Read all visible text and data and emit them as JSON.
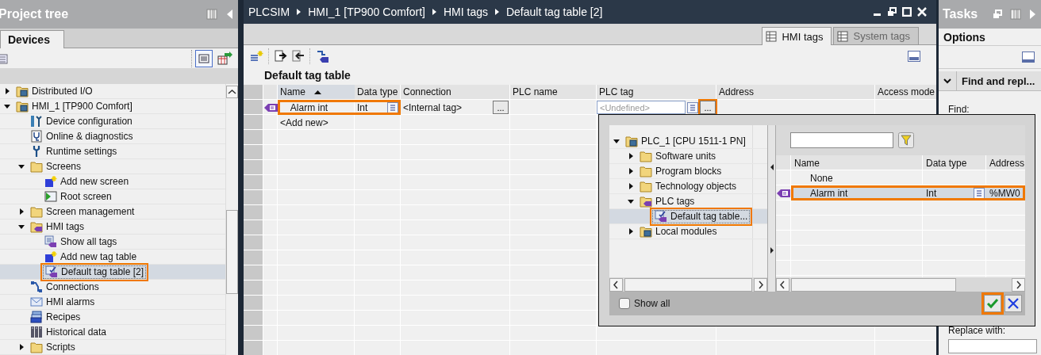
{
  "project_tree": {
    "title": "Project tree",
    "tabs": [
      {
        "label": "Devices",
        "selected": true
      }
    ],
    "items": [
      {
        "label": "Distributed I/O",
        "kind": "device-folder",
        "expanded": false,
        "selected": false,
        "highlighted": false
      },
      {
        "label": "HMI_1 [TP900 Comfort]",
        "kind": "device-folder",
        "expanded": true,
        "selected": false,
        "highlighted": false,
        "children": [
          {
            "label": "Device configuration",
            "kind": "config",
            "selected": false,
            "highlighted": false
          },
          {
            "label": "Online & diagnostics",
            "kind": "diagnostics",
            "selected": false,
            "highlighted": false
          },
          {
            "label": "Runtime settings",
            "kind": "runtime",
            "selected": false,
            "highlighted": false
          },
          {
            "label": "Screens",
            "kind": "folder",
            "expanded": true,
            "selected": false,
            "highlighted": false,
            "children": [
              {
                "label": "Add new screen",
                "kind": "add",
                "selected": false,
                "highlighted": false
              },
              {
                "label": "Root screen",
                "kind": "screen",
                "selected": false,
                "highlighted": false
              }
            ]
          },
          {
            "label": "Screen management",
            "kind": "folder",
            "expanded": false,
            "selected": false,
            "highlighted": false
          },
          {
            "label": "HMI tags",
            "kind": "tag-folder",
            "expanded": true,
            "selected": false,
            "highlighted": false,
            "children": [
              {
                "label": "Show all tags",
                "kind": "tags",
                "selected": false,
                "highlighted": false
              },
              {
                "label": "Add new tag table",
                "kind": "add",
                "selected": false,
                "highlighted": false
              },
              {
                "label": "Default tag table [2]",
                "kind": "tag-table",
                "selected": true,
                "highlighted": true
              }
            ]
          },
          {
            "label": "Connections",
            "kind": "connections",
            "selected": false,
            "highlighted": false
          },
          {
            "label": "HMI alarms",
            "kind": "alarms",
            "selected": false,
            "highlighted": false
          },
          {
            "label": "Recipes",
            "kind": "recipes",
            "selected": false,
            "highlighted": false
          },
          {
            "label": "Historical data",
            "kind": "historical",
            "selected": false,
            "highlighted": false
          },
          {
            "label": "Scripts",
            "kind": "folder",
            "expanded": false,
            "selected": false,
            "highlighted": false
          }
        ]
      }
    ]
  },
  "editor": {
    "breadcrumb": [
      "PLCSIM",
      "HMI_1 [TP900 Comfort]",
      "HMI tags",
      "Default tag table [2]"
    ],
    "tabs": [
      {
        "label": "HMI tags",
        "selected": true
      },
      {
        "label": "System tags",
        "selected": false
      }
    ],
    "table_title": "Default tag table",
    "columns": [
      {
        "label": "Name",
        "sorted": true
      },
      {
        "label": "Data type",
        "sorted": false
      },
      {
        "label": "Connection",
        "sorted": false
      },
      {
        "label": "PLC name",
        "sorted": false
      },
      {
        "label": "PLC tag",
        "sorted": false
      },
      {
        "label": "Address",
        "sorted": false
      },
      {
        "label": "Access mode",
        "sorted": false
      }
    ],
    "rows": [
      {
        "name": "Alarm int",
        "data_type": "Int",
        "connection": "<Internal tag>",
        "connection_button": "...",
        "plc_tag": {
          "placeholder": "<Undefined>",
          "button": "...",
          "button_highlighted": true
        },
        "highlighted": true
      }
    ],
    "add_row": "<Add new>"
  },
  "tag_picker": {
    "tree": [
      {
        "label": "PLC_1 [CPU 1511-1 PN]",
        "kind": "device-folder",
        "expanded": true,
        "selected": false,
        "highlighted": false,
        "children": [
          {
            "label": "Software units",
            "kind": "folder",
            "expanded": false,
            "selected": false,
            "highlighted": false
          },
          {
            "label": "Program blocks",
            "kind": "folder",
            "expanded": false,
            "selected": false,
            "highlighted": false
          },
          {
            "label": "Technology objects",
            "kind": "folder",
            "expanded": false,
            "selected": false,
            "highlighted": false
          },
          {
            "label": "PLC tags",
            "kind": "tag-folder",
            "expanded": true,
            "selected": false,
            "highlighted": false,
            "children": [
              {
                "label": "Default tag table...",
                "kind": "tag-table",
                "selected": true,
                "highlighted": true
              }
            ]
          },
          {
            "label": "Local modules",
            "kind": "device-folder",
            "expanded": false,
            "selected": false,
            "highlighted": false
          }
        ]
      }
    ],
    "columns": [
      "Name",
      "Data type",
      "Address"
    ],
    "rows": [
      {
        "name": "None",
        "selected": false,
        "highlighted": false
      },
      {
        "name": "Alarm int",
        "data_type": "Int",
        "address": "%MW0",
        "selected": true,
        "highlighted": true
      }
    ],
    "show_all": {
      "label": "Show all",
      "checked": false
    },
    "ok_highlighted": true
  },
  "tasks": {
    "title": "Tasks",
    "tab": "Options",
    "section": {
      "title": "Find and repl...",
      "expanded": true
    },
    "find_label": "Find:",
    "replace_label": "Replace with:"
  }
}
